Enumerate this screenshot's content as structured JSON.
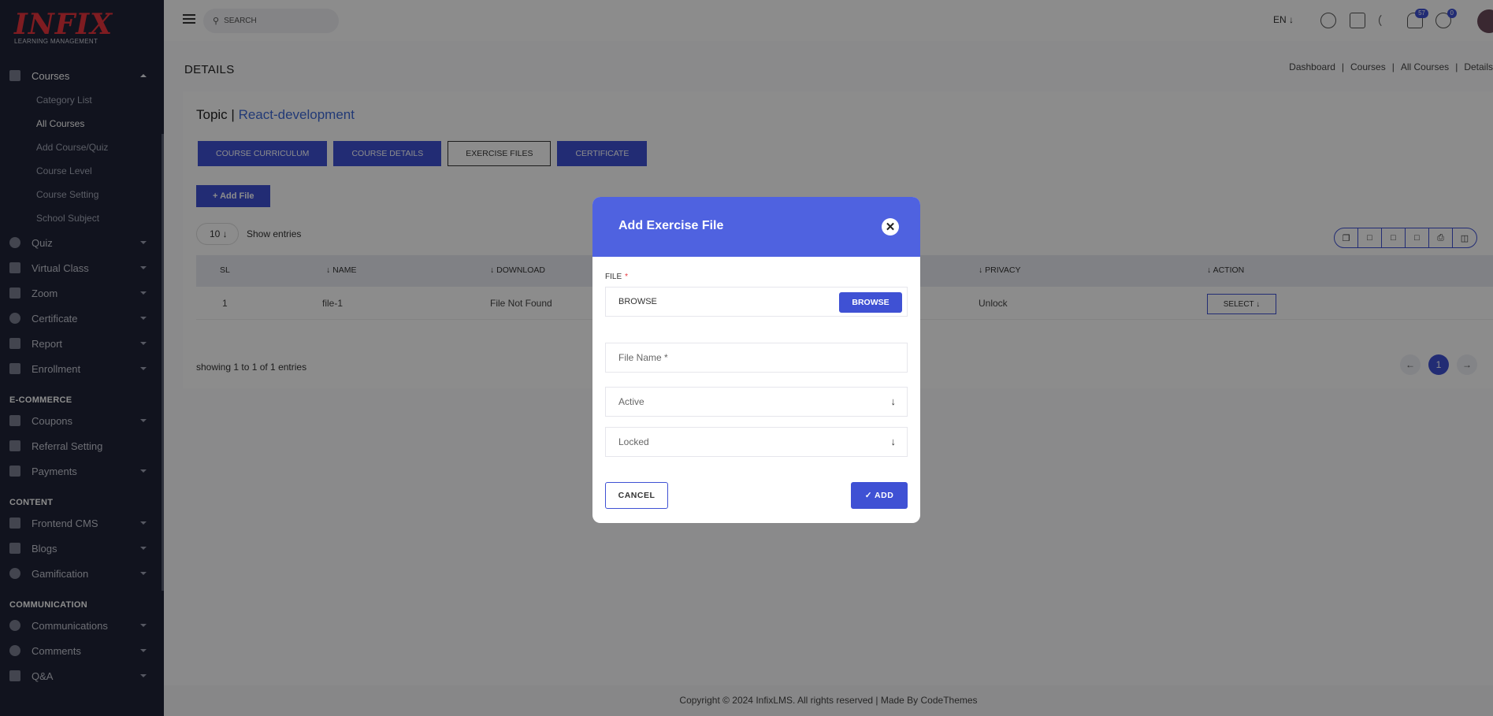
{
  "brand": {
    "logo": "INFIX",
    "tagline": "LEARNING MANAGEMENT",
    "accent": "#3f51d4",
    "logo_color": "#e8343c"
  },
  "sidebar": {
    "courses": {
      "label": "Courses",
      "children": [
        "Category List",
        "All Courses",
        "Add Course/Quiz",
        "Course Level",
        "Course Setting",
        "School Subject"
      ]
    },
    "items": [
      {
        "label": "Quiz",
        "icon": "question-icon"
      },
      {
        "label": "Virtual Class",
        "icon": "video-icon"
      },
      {
        "label": "Zoom",
        "icon": "grid-icon"
      },
      {
        "label": "Certificate",
        "icon": "badge-icon"
      },
      {
        "label": "Report",
        "icon": "chart-icon"
      },
      {
        "label": "Enrollment",
        "icon": "enroll-icon"
      }
    ],
    "sec_ecommerce": "E-COMMERCE",
    "ecom": [
      {
        "label": "Coupons"
      },
      {
        "label": "Referral Setting"
      },
      {
        "label": "Payments"
      }
    ],
    "sec_content": "CONTENT",
    "content": [
      {
        "label": "Frontend CMS"
      },
      {
        "label": "Blogs"
      },
      {
        "label": "Gamification"
      }
    ],
    "sec_communication": "COMMUNICATION",
    "comm": [
      {
        "label": "Communications"
      },
      {
        "label": "Comments"
      },
      {
        "label": "Q&A"
      }
    ]
  },
  "topbar": {
    "search_placeholder": "SEARCH",
    "lang": "EN ↓",
    "notif_count": "57",
    "msg_count": "0"
  },
  "page": {
    "title": "DETAILS",
    "breadcrumb": [
      "Dashboard",
      "Courses",
      "All Courses",
      "Details"
    ]
  },
  "card": {
    "topic_prefix": "Topic |",
    "topic_name": "React-development",
    "tabs": [
      "COURSE CURRICULUM",
      "COURSE DETAILS",
      "EXERCISE FILES",
      "CERTIFICATE"
    ],
    "add_file": "+ Add File",
    "entries_value": "10 ↓",
    "entries_label": "Show entries",
    "columns": [
      "SL",
      "↓ NAME",
      "↓ DOWNLOAD",
      "↓ PRIVACY",
      "↓ ACTION"
    ],
    "row": {
      "sl": "1",
      "name": "file-1",
      "download": "File Not Found",
      "privacy": "Unlock",
      "action": "SELECT ↓"
    },
    "showing": "showing 1 to 1 of 1 entries",
    "page": "1"
  },
  "footer": "Copyright © 2024 InfixLMS. All rights reserved | Made By CodeThemes",
  "modal": {
    "title": "Add Exercise File",
    "close": "✕",
    "file_label": "FILE",
    "required": "*",
    "file_value": "BROWSE",
    "browse": "BROWSE",
    "file_name_placeholder": "File Name *",
    "status": "Active",
    "privacy": "Locked",
    "cancel": "CANCEL",
    "add": "✓ ADD"
  }
}
